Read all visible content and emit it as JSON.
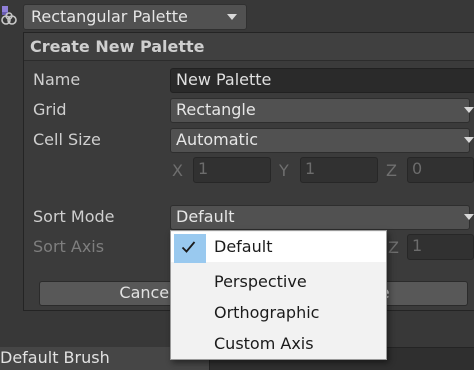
{
  "toolbar": {
    "icon": "tile-palette-tools-icon",
    "palette_dropdown": {
      "value": "Rectangular Palette"
    }
  },
  "create_palette": {
    "title": "Create New Palette",
    "name": {
      "label": "Name",
      "value": "New Palette"
    },
    "grid": {
      "label": "Grid",
      "value": "Rectangle"
    },
    "cell_size": {
      "label": "Cell Size",
      "value": "Automatic",
      "x": {
        "label": "X",
        "value": "1"
      },
      "y": {
        "label": "Y",
        "value": "1"
      },
      "z": {
        "label": "Z",
        "value": "0"
      }
    },
    "sort_mode": {
      "label": "Sort Mode",
      "value": "Default"
    },
    "sort_axis": {
      "label": "Sort Axis",
      "z": {
        "label": "Z",
        "value": "1"
      }
    },
    "buttons": {
      "cancel": "Cancel",
      "create": "Create"
    }
  },
  "sort_mode_menu": {
    "items": [
      {
        "label": "Default",
        "checked": true
      },
      {
        "label": "Perspective",
        "checked": false
      },
      {
        "label": "Orthographic",
        "checked": false
      },
      {
        "label": "Custom Axis",
        "checked": false
      }
    ]
  },
  "brush_bar": {
    "label": "Default Brush"
  },
  "colors": {
    "menu_check_highlight": "#99c9ef",
    "panel_bg": "#3b3b3b",
    "menu_bg": "#f2f2f2"
  }
}
